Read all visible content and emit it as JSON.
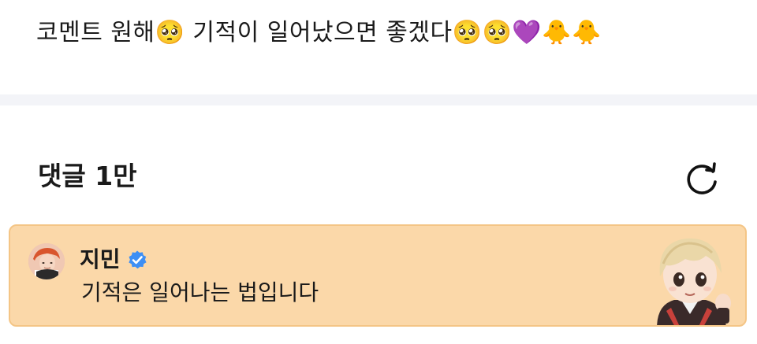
{
  "post": {
    "text": "코멘트 원해🥺 기적이 일어났으면 좋겠다🥺🥺💜🐥🐥"
  },
  "comments": {
    "title": "댓글",
    "count": "1만",
    "refresh_icon": "refresh-icon"
  },
  "highlighted_comment": {
    "author": "지민",
    "verified_icon": "verified-badge-icon",
    "text": "기적은 일어나는 법입니다",
    "background_color": "#fbd8a9",
    "border_color": "#f4c586"
  },
  "colors": {
    "verified_blue": "#3d8ff5",
    "divider": "#f3f4f8"
  }
}
